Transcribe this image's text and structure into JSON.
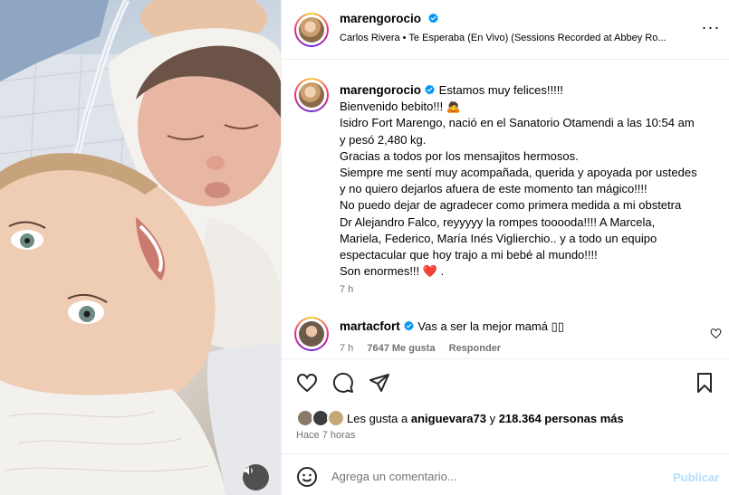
{
  "post": {
    "username": "marengorocio",
    "song": "Carlos Rivera • Te Esperaba (En Vivo) (Sessions Recorded at Abbey Ro...",
    "more_label": "···"
  },
  "caption": {
    "username": "marengorocio",
    "lines": [
      "Estamos muy felices!!!!!",
      "Bienvenido bebito!!! 🙇",
      "Isidro Fort Marengo, nació en el Sanatorio Otamendi a las 10:54 am",
      "y pesó 2,480 kg.",
      "Gracias a todos por los mensajitos hermosos.",
      "Siempre me sentí muy acompañada, querida y apoyada por ustedes",
      "y no quiero dejarlos afuera de este momento tan mágico!!!!",
      "No puedo dejar de agradecer como primera medida a mi obstetra",
      "Dr Alejandro Falco, reyyyyy la rompes tooooda!!!! A Marcela,",
      "Mariela, Federico, María Inés Viglierchio.. y a todo un equipo",
      "espectacular que hoy trajo a mi bebé al mundo!!!!",
      "Son enormes!!! ❤️ ."
    ],
    "time": "7 h"
  },
  "comment": {
    "username": "martacfort",
    "text": "Vas a ser la mejor mamá ▯▯",
    "time": "7 h",
    "likes": "7647 Me gusta",
    "reply": "Responder"
  },
  "likes": {
    "prefix": "Les gusta a",
    "user": "aniguevara73",
    "connector": "y",
    "others": "218.364 personas más"
  },
  "posted_ago": "Hace 7 horas",
  "add_comment": {
    "placeholder": "Agrega un comentario...",
    "publish": "Publicar"
  },
  "colors": {
    "verified": "#0095f6",
    "publish": "#b2dffc",
    "heart": "#ed1c24"
  },
  "icons": [
    "audio-icon",
    "verified-icon",
    "more-icon",
    "heart-icon",
    "comment-icon",
    "share-icon",
    "save-icon",
    "emoji-icon"
  ]
}
